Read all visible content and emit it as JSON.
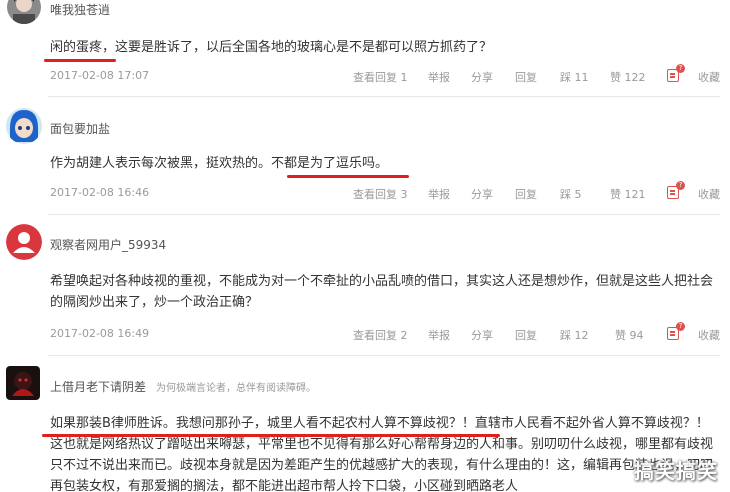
{
  "comments": [
    {
      "username": "唯我独苍逍",
      "text_parts": [
        "闲的蛋疼",
        "，这要是胜诉了，以后全国各地的玻璃心是不是都可以照方抓药了？"
      ],
      "date": "2017-02-08 17:07",
      "actions": {
        "view_replies": "查看回复 1",
        "report": "举报",
        "share": "分享",
        "reply": "回复",
        "dislike": "踩 11",
        "like": "赞 122",
        "favorite": "收藏"
      },
      "avatar_colors": {
        "bg": "#8a8a8a",
        "hair": "#2b2b2b",
        "face": "#e9d6c8"
      }
    },
    {
      "username": "面包要加盐",
      "text_parts": [
        "作为胡建人表示每次被黑，挺欢热的。",
        "不都是为了逗乐吗",
        "。"
      ],
      "date": "2017-02-08 16:46",
      "actions": {
        "view_replies": "查看回复 3",
        "report": "举报",
        "share": "分享",
        "reply": "回复",
        "dislike": "踩 5",
        "like": "赞 121",
        "favorite": "收藏"
      },
      "avatar_colors": {
        "bg": "#cfe8f7",
        "hair": "#1e63c9",
        "face": "#f3dcc9"
      }
    },
    {
      "username": "观察者网用户_59934",
      "text": "希望唤起对各种歧视的重视，不能成为对一个不牵扯的小品乱喷的借口，其实这人还是想炒作，但就是这些人把社会的隔阂炒出来了，炒一个政治正确？",
      "date": "2017-02-08 16:49",
      "actions": {
        "view_replies": "查看回复 2",
        "report": "举报",
        "share": "分享",
        "reply": "回复",
        "dislike": "踩 12",
        "like": "赞 94",
        "favorite": "收藏"
      },
      "avatar_colors": {
        "bg": "#d9363e",
        "figure": "#ffffff"
      }
    },
    {
      "username": "上借月老下请阴差",
      "note": "为何极端言论者，总伴有阅读障碍。",
      "text_parts": [
        "如果那装B律师胜诉。我想问那孙子，城里人看不起农村人算不算歧视？！",
        "直辖市人民看不起外省人算不算歧视？！这也就是网络热议了蹭哒出来嘚瑟，平常里也不见得有那么好心帮帮身边的人和事。别叨叨什么歧视，哪里都有歧视只不过不说出来而已。歧视本身就是因为差距产生的优越感扩大的表现，有什么理由的！",
        "这，编辑再包装也讽，叨叨再包装女权，有那爱搁的搁法，都不能进出超市帮人拎下口袋，小区碰到晒路老人"
      ],
      "avatar_colors": {
        "bg": "#1a1010",
        "accent": "#b01818"
      }
    }
  ],
  "watermark": "搞笑搞笑"
}
